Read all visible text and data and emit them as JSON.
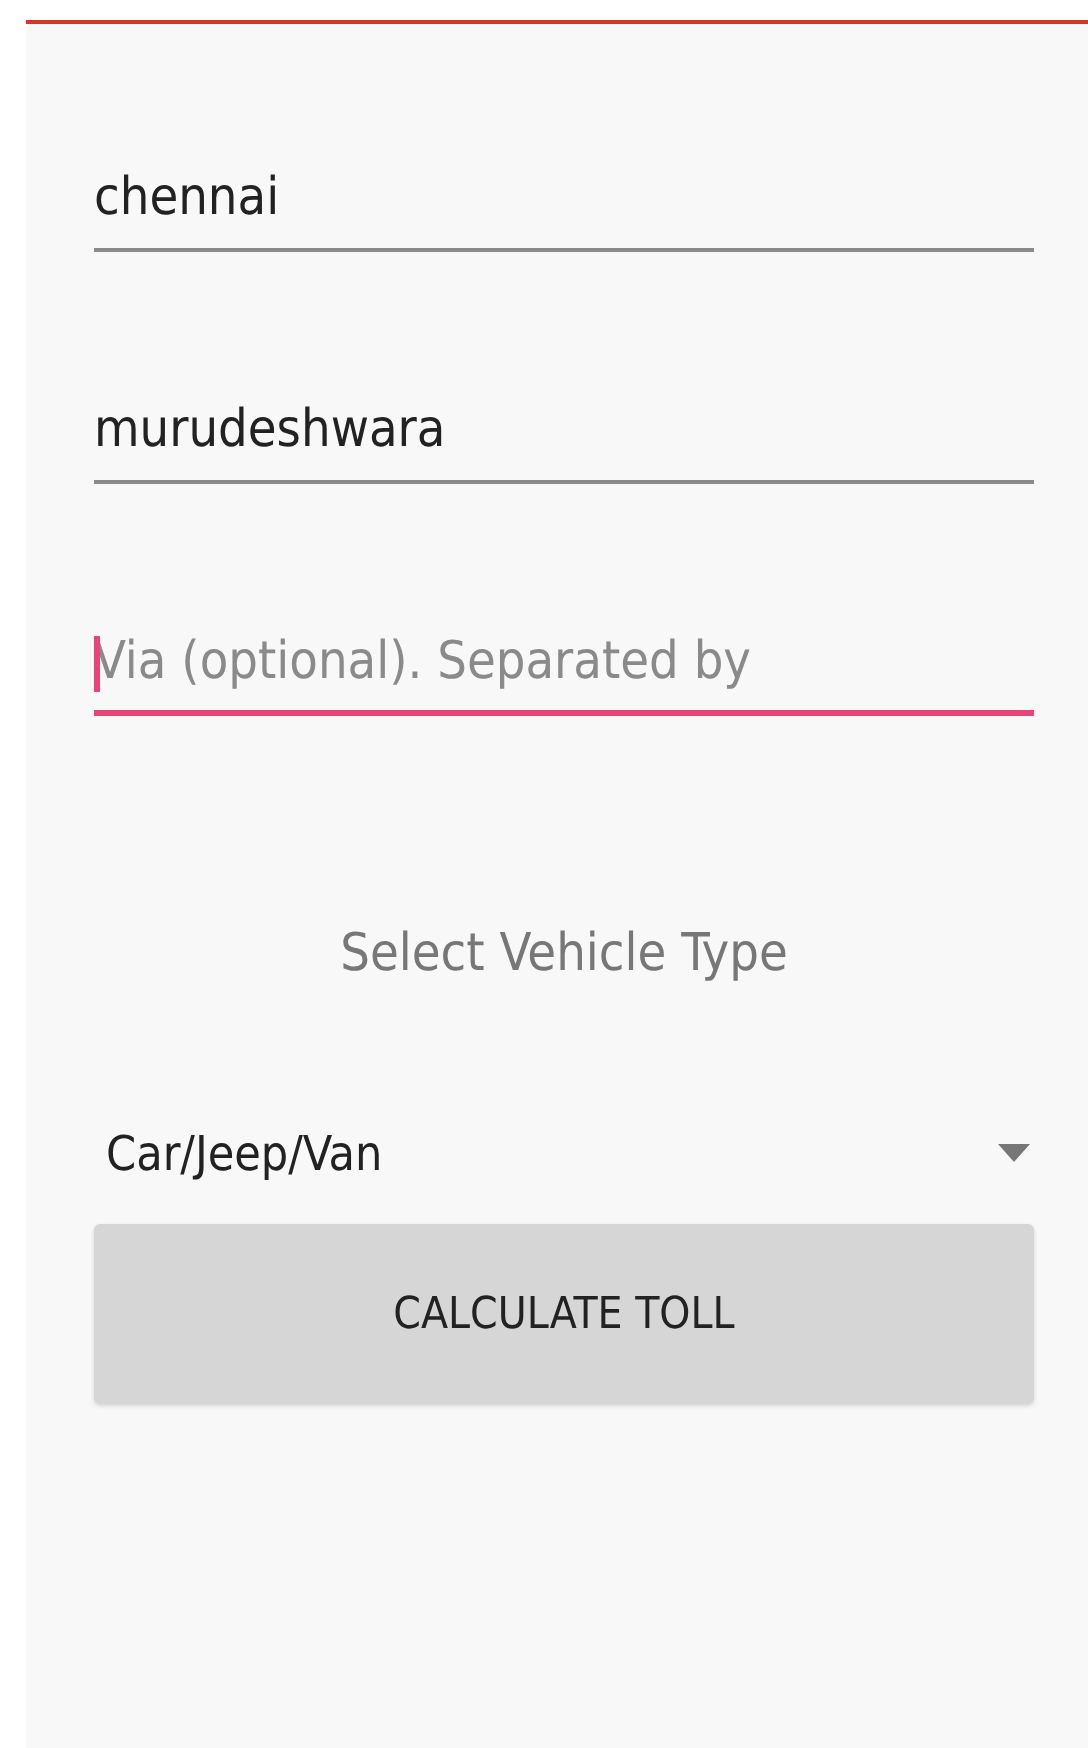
{
  "fields": [
    {
      "value": "chennai",
      "focused": false
    },
    {
      "value": "murudeshwara",
      "focused": false
    },
    {
      "placeholder": "Via (optional). Separated by",
      "focused": true
    }
  ],
  "vehicle_label": "Select Vehicle Type",
  "vehicle_dropdown": {
    "value": "Car/Jeep/Van"
  },
  "calculate_button": "CALCULATE TOLL"
}
